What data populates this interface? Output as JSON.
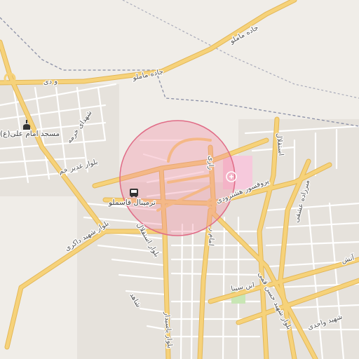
{
  "map": {
    "labels": {
      "road_mamalu": "جاده ماملو",
      "road_mamalu_2": "جاده ماملو",
      "road_west": "و دی",
      "street_khormeh": "شهدای خرمه",
      "mosque": "مسجد امام علی(ع)",
      "boulevard_ghadir": "بلوار غدیر خم",
      "terminal": "ترمینال قاسملو",
      "boulevard_esteqlal": "بلوار استقلال",
      "professor_hashtroodi": "پروفسور هشترودی",
      "mirza_eshqi": "میرزاده عشقی",
      "esteqlal": "استقلال",
      "razi": "رازی",
      "street_c": "امام ر",
      "boulevard_dakari": "بلوار شهید داکری",
      "ibn_sina": "ابن سینا",
      "shahid_hasan_ghomi": "بلوار شهید حسن قمی",
      "shahid_vahedi": "شهید واحدی",
      "atash": "آتش",
      "shahed": "شاهد",
      "bottom_label": "بلوار یاسیدار"
    },
    "colors": {
      "background": "#f0ede8",
      "major_road": "#f6d27a",
      "major_road_casing": "#e3b757",
      "minor_road": "#ffffff",
      "boundary": "#8a8fa6",
      "highlight_circle": "#f08aa0",
      "hospital_area": "#f6c9dc",
      "park": "#c8e6b4"
    },
    "icons": [
      "mosque-icon",
      "bus-icon",
      "hospital-icon"
    ]
  }
}
